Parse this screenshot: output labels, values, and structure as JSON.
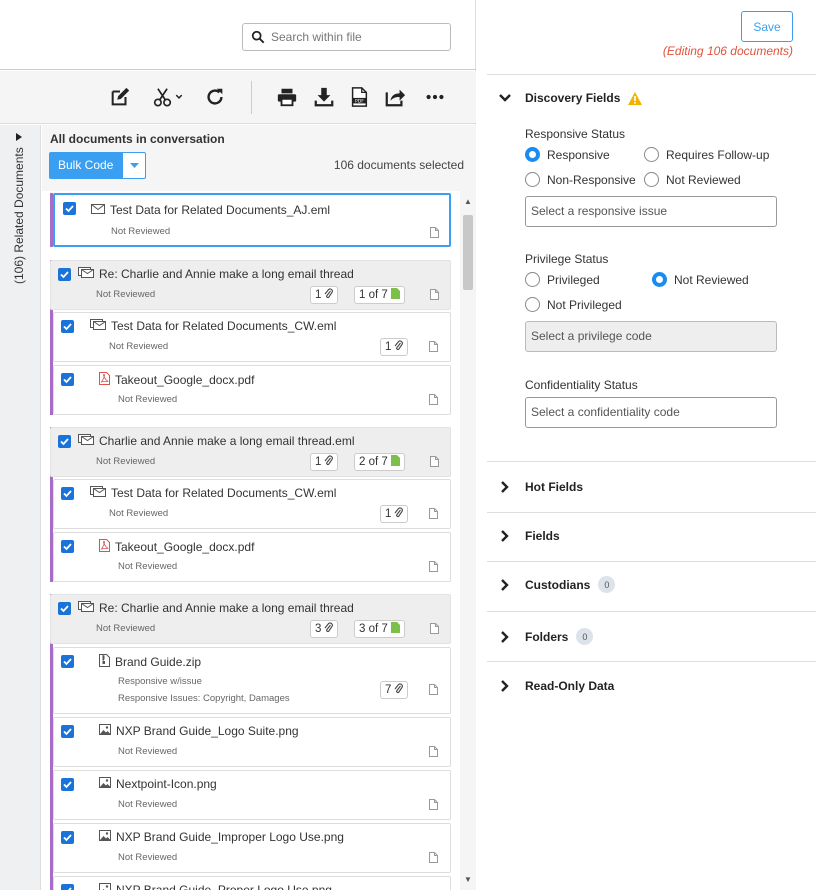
{
  "search": {
    "placeholder": "Search within file"
  },
  "side_tab": {
    "label": "(106) Related Documents"
  },
  "list_header": {
    "title": "All documents in conversation",
    "bulk_code_label": "Bulk Code",
    "selected_count": "106 documents selected"
  },
  "documents": [
    {
      "name": "Test Data for Related Documents_AJ.eml",
      "status": "Not Reviewed",
      "icon": "envelope-icon",
      "checked": true
    },
    {
      "name": "Re: Charlie and Annie make a long email thread",
      "status": "Not Reviewed",
      "icon": "email-thread-icon",
      "attachments": "1",
      "position": "1 of 7",
      "checked": true
    },
    {
      "name": "Test Data for Related Documents_CW.eml",
      "status": "Not Reviewed",
      "icon": "email-thread-icon",
      "attachments": "1",
      "checked": true
    },
    {
      "name": "Takeout_Google_docx.pdf",
      "status": "Not Reviewed",
      "icon": "pdf-icon",
      "checked": true
    },
    {
      "name": "Charlie and Annie make a long email thread.eml",
      "status": "Not Reviewed",
      "icon": "email-thread-icon",
      "attachments": "1",
      "position": "2 of 7",
      "checked": true
    },
    {
      "name": "Test Data for Related Documents_CW.eml",
      "status": "Not Reviewed",
      "icon": "email-thread-icon",
      "attachments": "1",
      "checked": true
    },
    {
      "name": "Takeout_Google_docx.pdf",
      "status": "Not Reviewed",
      "icon": "pdf-icon",
      "checked": true
    },
    {
      "name": "Re: Charlie and Annie make a long email thread",
      "status": "Not Reviewed",
      "icon": "email-thread-icon",
      "attachments": "3",
      "position": "3 of 7",
      "checked": true
    },
    {
      "name": "Brand Guide.zip",
      "status": "Responsive w/issue",
      "status2": "Responsive Issues: Copyright, Damages",
      "icon": "zip-icon",
      "attachments": "7",
      "checked": true
    },
    {
      "name": "NXP Brand Guide_Logo Suite.png",
      "status": "Not Reviewed",
      "icon": "image-icon",
      "checked": true
    },
    {
      "name": "Nextpoint-Icon.png",
      "status": "Not Reviewed",
      "icon": "image-icon",
      "checked": true
    },
    {
      "name": "NXP Brand Guide_Improper Logo Use.png",
      "status": "Not Reviewed",
      "icon": "image-icon",
      "checked": true
    },
    {
      "name": "NXP Brand Guide_Proper Logo Use.png",
      "status": "",
      "icon": "image-icon",
      "checked": true
    }
  ],
  "right_panel": {
    "save_label": "Save",
    "editing_note": "(Editing 106 documents)",
    "discovery": {
      "title": "Discovery Fields",
      "responsive_label": "Responsive Status",
      "responsive_options": [
        "Responsive",
        "Requires Follow-up",
        "Non-Responsive",
        "Not Reviewed"
      ],
      "responsive_selected": "Responsive",
      "responsive_issue_placeholder": "Select a responsive issue",
      "privilege_label": "Privilege Status",
      "privilege_options": [
        "Privileged",
        "Not Reviewed",
        "Not Privileged"
      ],
      "privilege_selected": "Not Reviewed",
      "privilege_code_placeholder": "Select a privilege code",
      "confidentiality_label": "Confidentiality Status",
      "confidentiality_placeholder": "Select a confidentiality code"
    },
    "sections": [
      {
        "title": "Hot Fields"
      },
      {
        "title": "Fields"
      },
      {
        "title": "Custodians",
        "count": "0"
      },
      {
        "title": "Folders",
        "count": "0"
      },
      {
        "title": "Read-Only Data"
      }
    ]
  },
  "colors": {
    "accent": "#3a9ff0",
    "group_border": "#a66cc7",
    "warning": "#f0b400",
    "error_text": "#e0533b"
  }
}
